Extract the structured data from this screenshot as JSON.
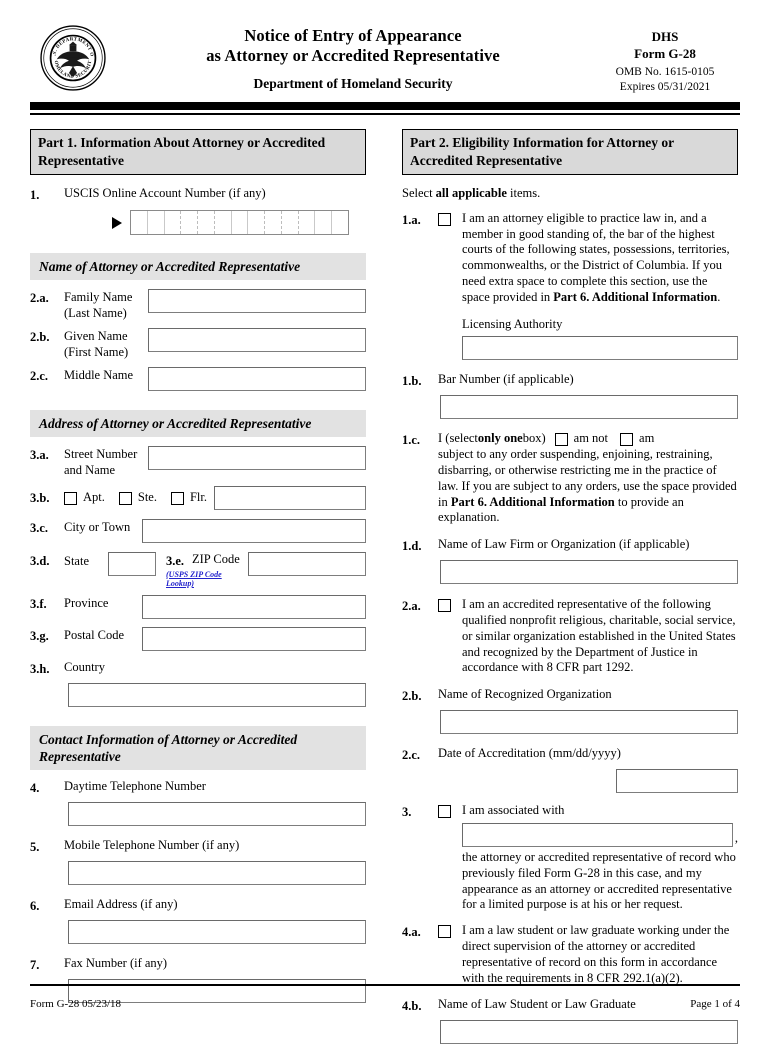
{
  "header": {
    "seal_icon": "dhs-seal-icon",
    "title_line1": "Notice of Entry of Appearance",
    "title_line2": "as Attorney or Accredited Representative",
    "title_line3": "Department of Homeland Security",
    "agency": "DHS",
    "form_number": "Form G-28",
    "omb_number": "OMB No. 1615-0105",
    "expires": "Expires 05/31/2021"
  },
  "part1": {
    "header": "Part 1.  Information About Attorney or Accredited Representative",
    "item1": {
      "num": "1.",
      "label": "USCIS Online Account Number (if any)",
      "arrow_icon": "right-triangle-icon",
      "cell_count": 13
    },
    "name_section": {
      "heading": "Name of Attorney or Accredited Representative",
      "fields": [
        {
          "num": "2.a.",
          "label_line1": "Family Name",
          "label_line2": "(Last Name)",
          "value": ""
        },
        {
          "num": "2.b.",
          "label_line1": "Given Name",
          "label_line2": "(First Name)",
          "value": ""
        },
        {
          "num": "2.c.",
          "label_line1": "Middle Name",
          "label_line2": "",
          "value": ""
        }
      ]
    },
    "address_section": {
      "heading": "Address of Attorney or Accredited Representative",
      "street": {
        "num": "3.a.",
        "label_line1": "Street Number",
        "label_line2": "and Name",
        "value": ""
      },
      "unit": {
        "num": "3.b.",
        "options": [
          {
            "label": "Apt.",
            "checked": false
          },
          {
            "label": "Ste.",
            "checked": false
          },
          {
            "label": "Flr.",
            "checked": false
          }
        ],
        "value": ""
      },
      "city": {
        "num": "3.c.",
        "label": "City or Town",
        "value": ""
      },
      "state": {
        "num": "3.d.",
        "label": "State",
        "value": ""
      },
      "zip": {
        "num": "3.e.",
        "label": "ZIP Code",
        "link": "(USPS ZIP Code Lookup)",
        "value": ""
      },
      "province": {
        "num": "3.f.",
        "label": "Province",
        "value": ""
      },
      "postal": {
        "num": "3.g.",
        "label": "Postal Code",
        "value": ""
      },
      "country": {
        "num": "3.h.",
        "label": "Country",
        "value": ""
      }
    },
    "contact_section": {
      "heading": "Contact Information of Attorney or Accredited Representative",
      "fields": [
        {
          "num": "4.",
          "label": "Daytime Telephone Number",
          "value": ""
        },
        {
          "num": "5.",
          "label": "Mobile Telephone Number (if any)",
          "value": ""
        },
        {
          "num": "6.",
          "label": "Email Address (if any)",
          "value": ""
        },
        {
          "num": "7.",
          "label": "Fax Number (if any)",
          "value": ""
        }
      ]
    }
  },
  "part2": {
    "header": "Part 2.  Eligibility Information for Attorney or Accredited Representative",
    "instruction_pre": "Select ",
    "instruction_bold": "all applicable",
    "instruction_post": " items.",
    "item1a": {
      "num": "1.a.",
      "checked": false,
      "text_pre": "I am an attorney eligible to practice law in, and a member in good standing of, the bar of the highest courts of the following states, possessions, territories, commonwealths, or the District of Columbia.  If you need extra space to complete this section, use the space provided in ",
      "text_bold": "Part 6. Additional Information",
      "text_post": ".",
      "sub_label": "Licensing Authority",
      "value": ""
    },
    "item1b": {
      "num": "1.b.",
      "label": "Bar Number (if applicable)",
      "value": ""
    },
    "item1c": {
      "num": "1.c.",
      "lead_pre": "I (select ",
      "lead_bold": "only one",
      "lead_post": " box)",
      "opt1": {
        "label": "am not",
        "checked": false
      },
      "opt2": {
        "label": "am",
        "checked": false
      },
      "text_pre": "subject to any order suspending, enjoining, restraining, disbarring, or otherwise restricting me in the practice of law.  If you are subject to any orders, use the space provided in ",
      "text_bold": "Part 6. Additional Information",
      "text_post": " to provide an explanation."
    },
    "item1d": {
      "num": "1.d.",
      "label": "Name of Law Firm or Organization (if applicable)",
      "value": ""
    },
    "item2a": {
      "num": "2.a.",
      "checked": false,
      "text": "I am an accredited representative of the following qualified nonprofit religious, charitable, social service, or similar organization established in the United States and recognized by the Department of Justice in accordance with 8 CFR part 1292."
    },
    "item2b": {
      "num": "2.b.",
      "label": "Name of Recognized Organization",
      "value": ""
    },
    "item2c": {
      "num": "2.c.",
      "label": "Date of Accreditation (mm/dd/yyyy)",
      "value": ""
    },
    "item3": {
      "num": "3.",
      "checked": false,
      "lead": "I am associated with",
      "value": "",
      "comma": ",",
      "text": "the attorney or accredited representative of record who previously filed Form G-28 in this case, and my appearance as an attorney or accredited representative for a limited purpose is at his or her request."
    },
    "item4a": {
      "num": "4.a.",
      "checked": false,
      "text": "I am a law student or law graduate working under the direct supervision of the attorney or accredited representative of record on this form in accordance with the requirements in 8 CFR 292.1(a)(2)."
    },
    "item4b": {
      "num": "4.b.",
      "label": "Name of Law Student or Law Graduate",
      "value": ""
    }
  },
  "footer": {
    "left": "Form G-28   05/23/18",
    "right": "Page 1 of 4"
  }
}
